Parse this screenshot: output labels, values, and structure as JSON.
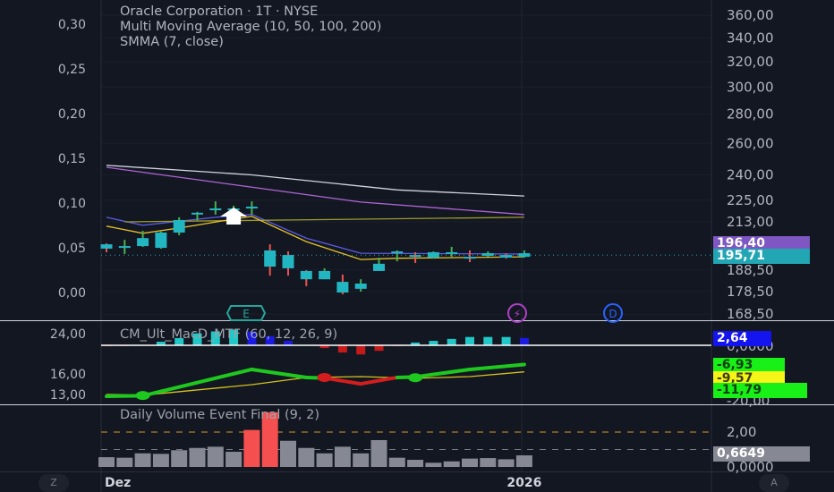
{
  "header": {
    "symbol_line": "Oracle Corporation · 1T · NYSE",
    "indicator_1": "Multi Moving Average (10, 50, 100, 200)",
    "indicator_2": "SMMA (7, close)"
  },
  "colors": {
    "background": "#131722",
    "candle_body": "#22b5c2",
    "wick_up": "#4caf50",
    "wick_down": "#ef5350",
    "ma_200": "#d1d4dc",
    "ma_100": "#b066d6",
    "ma_50": "#5b5ce6",
    "ma_10": "#9a9a2e",
    "smma": "#e6c229",
    "macd_up": "#1ec81e",
    "macd_down": "#d41e1e",
    "signal": "#d4c21e",
    "hist_up": "#22c7c7",
    "hist_fall": "#1a1ae0",
    "hist_neg": "#c41a1a",
    "vol_normal": "#868993",
    "vol_event": "#f5504f"
  },
  "main_pane": {
    "right_axis": [
      "360,00",
      "340,00",
      "320,00",
      "300,00",
      "280,00",
      "260,00",
      "240,00",
      "225,00",
      "213,00",
      "188,50",
      "178,50",
      "168,50"
    ],
    "right_axis_values": [
      360,
      340,
      320,
      300,
      280,
      260,
      240,
      225,
      213,
      188.5,
      178.5,
      168.5
    ],
    "left_axis": [
      "0,30",
      "0,25",
      "0,20",
      "0,15",
      "0,10",
      "0,05",
      "0,00"
    ],
    "left_axis_values": [
      0.3,
      0.25,
      0.2,
      0.15,
      0.1,
      0.05,
      0.0
    ],
    "price_tags": [
      {
        "label": "196,40",
        "value": 196.4,
        "color": "#7e57c2"
      },
      {
        "label": "195,71",
        "value": 195.71,
        "color": "#22a6b3"
      }
    ],
    "last_price": 195.71,
    "candles": [
      {
        "o": 201.2,
        "h": 201.7,
        "l": 197.2,
        "c": 199.0
      },
      {
        "o": 200.3,
        "h": 203.5,
        "l": 196.3,
        "c": 200.3
      },
      {
        "o": 200.3,
        "h": 208.2,
        "l": 199.9,
        "c": 204.4
      },
      {
        "o": 199.4,
        "h": 207.8,
        "l": 199.0,
        "c": 207.3
      },
      {
        "o": 207.3,
        "h": 215.5,
        "l": 205.9,
        "c": 214.0
      },
      {
        "o": 218.0,
        "h": 218.5,
        "l": 213.6,
        "c": 218.0
      },
      {
        "o": 220.4,
        "h": 224.4,
        "l": 217.0,
        "c": 220.4
      },
      {
        "o": 220.4,
        "h": 221.9,
        "l": 219.0,
        "c": 220.4
      },
      {
        "o": 221.4,
        "h": 224.4,
        "l": 217.0,
        "c": 221.4
      },
      {
        "o": 198.1,
        "h": 201.2,
        "l": 185.8,
        "c": 190.1
      },
      {
        "o": 195.8,
        "h": 197.6,
        "l": 185.8,
        "c": 189.3
      },
      {
        "o": 188.0,
        "h": 188.4,
        "l": 180.9,
        "c": 184.1
      },
      {
        "o": 184.1,
        "h": 189.3,
        "l": 184.1,
        "c": 188.0
      },
      {
        "o": 182.9,
        "h": 186.3,
        "l": 177.2,
        "c": 178.0
      },
      {
        "o": 179.7,
        "h": 184.1,
        "l": 178.4,
        "c": 182.1
      },
      {
        "o": 188.0,
        "h": 194.5,
        "l": 188.0,
        "c": 191.5
      },
      {
        "o": 196.7,
        "h": 198.1,
        "l": 192.7,
        "c": 197.6
      },
      {
        "o": 195.8,
        "h": 197.2,
        "l": 191.9,
        "c": 194.9
      },
      {
        "o": 194.5,
        "h": 197.6,
        "l": 194.0,
        "c": 197.2
      },
      {
        "o": 197.2,
        "h": 199.9,
        "l": 194.9,
        "c": 197.2
      },
      {
        "o": 194.9,
        "h": 198.1,
        "l": 192.3,
        "c": 194.0
      },
      {
        "o": 195.4,
        "h": 197.6,
        "l": 194.9,
        "c": 196.7
      },
      {
        "o": 195.8,
        "h": 196.7,
        "l": 194.0,
        "c": 194.5
      },
      {
        "o": 194.9,
        "h": 198.1,
        "l": 194.5,
        "c": 196.7
      }
    ],
    "moving_averages": [
      {
        "name": "MA 200",
        "color_key": "ma_200",
        "points": [
          [
            0,
            245.9
          ],
          [
            8,
            240
          ],
          [
            16,
            231
          ],
          [
            23,
            227.5
          ]
        ]
      },
      {
        "name": "MA 100",
        "color_key": "ma_100",
        "points": [
          [
            0,
            244.7
          ],
          [
            9,
            231.2
          ],
          [
            14,
            224
          ],
          [
            23,
            217
          ]
        ]
      },
      {
        "name": "MA 50",
        "color_key": "ma_50",
        "points": [
          [
            0,
            215.5
          ],
          [
            2,
            211.2
          ],
          [
            6,
            215.5
          ],
          [
            8,
            217
          ],
          [
            11,
            204.4
          ],
          [
            14,
            196.7
          ],
          [
            23,
            196.3
          ]
        ]
      },
      {
        "name": "MA 10",
        "color_key": "ma_10",
        "points": [
          [
            1,
            213
          ],
          [
            23,
            215.5
          ]
        ]
      },
      {
        "name": "SMMA 7",
        "color_key": "smma",
        "points": [
          [
            0,
            210.7
          ],
          [
            2,
            206.9
          ],
          [
            4,
            209.7
          ],
          [
            7,
            214.5
          ],
          [
            8,
            216
          ],
          [
            11,
            202.6
          ],
          [
            14,
            193.6
          ],
          [
            16,
            194.2
          ],
          [
            23,
            194.9
          ]
        ]
      }
    ],
    "signal_arrow_index": 7,
    "events": [
      {
        "label": "E",
        "type": "earnings",
        "color": "#26a69a"
      },
      {
        "label": "⚡",
        "type": "split",
        "color": "#b040c8"
      },
      {
        "label": "D",
        "type": "dividend",
        "color": "#2962ff"
      }
    ]
  },
  "macd_pane": {
    "title": "CM_Ult_MacD_MTF (60, 12, 26, 9)",
    "left_axis": [
      "24,00",
      "16,00",
      "13,00"
    ],
    "right_axis": [
      "0,0000",
      "-20,00"
    ],
    "right_axis_values": [
      0,
      -20
    ],
    "histogram": [
      -0.3,
      -0.3,
      0,
      1.3,
      2.6,
      4.3,
      5,
      5.6,
      5,
      3.3,
      1.6,
      0,
      -1,
      -2.6,
      -3.3,
      -2,
      -0.3,
      1,
      1.6,
      2.3,
      3,
      3,
      3,
      2.64
    ],
    "macd_line": [
      [
        0,
        -18.4
      ],
      [
        2,
        -18.2
      ],
      [
        8,
        -8.7
      ],
      [
        11,
        -11.6
      ],
      [
        12,
        -11.8
      ],
      [
        14,
        -13.9
      ],
      [
        16,
        -11.6
      ],
      [
        17,
        -11.4
      ],
      [
        20,
        -8.7
      ],
      [
        23,
        -6.93
      ]
    ],
    "macd_red_range": [
      11.5,
      16.5
    ],
    "signal_line": [
      [
        0,
        -17.7
      ],
      [
        2,
        -18
      ],
      [
        8,
        -14.2
      ],
      [
        11,
        -11.6
      ],
      [
        14,
        -11.3
      ],
      [
        17,
        -11.9
      ],
      [
        20,
        -11.3
      ],
      [
        23,
        -9.57
      ]
    ],
    "cross_dots": [
      [
        2,
        -18.1,
        "up"
      ],
      [
        12,
        -11.6,
        "down"
      ],
      [
        17,
        -11.7,
        "up"
      ]
    ],
    "tags": [
      {
        "label": "2,64",
        "value": 2.64,
        "bg": "#1414f0",
        "fg": "#ffffff"
      },
      {
        "label": "-6,93",
        "value": -6.93,
        "bg": "#18f018",
        "fg": "#0b3d0b"
      },
      {
        "label": "-9,57",
        "value": -9.57,
        "bg": "#f5f518",
        "fg": "#3d3d0b"
      },
      {
        "label": "-11,79",
        "value": -11.79,
        "bg": "#18f018",
        "fg": "#0b3d0b"
      }
    ]
  },
  "volume_pane": {
    "title": "Daily Volume Event Final (9, 2)",
    "right_axis": [
      "2,00",
      "0,0000"
    ],
    "right_axis_values": [
      2,
      0
    ],
    "threshold_high": 2.0,
    "threshold_mid": 1.0,
    "bars": [
      0.56,
      0.53,
      0.78,
      0.75,
      0.96,
      1.09,
      1.16,
      0.87,
      2.12,
      3.14,
      1.5,
      1.09,
      0.78,
      1.16,
      0.78,
      1.54,
      0.53,
      0.41,
      0.24,
      0.32,
      0.48,
      0.51,
      0.44,
      0.6649
    ],
    "tag": {
      "label": "0,6649",
      "value": 0.6649
    }
  },
  "time_axis": {
    "labels": [
      "Dez",
      "2026"
    ],
    "label_indices": [
      0,
      23
    ]
  },
  "buttons": {
    "left": "Z",
    "right": "A"
  }
}
